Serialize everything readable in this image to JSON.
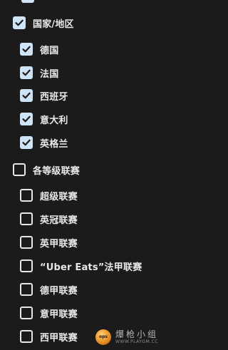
{
  "filters": {
    "country_group": {
      "label": "国家/地区",
      "checked": true,
      "items": [
        {
          "label": "德国",
          "checked": true
        },
        {
          "label": "法国",
          "checked": true
        },
        {
          "label": "西班牙",
          "checked": true
        },
        {
          "label": "意大利",
          "checked": true
        },
        {
          "label": "英格兰",
          "checked": true
        }
      ]
    },
    "league_group": {
      "label": "各等级联赛",
      "checked": false,
      "items": [
        {
          "label": "超级联赛",
          "checked": false
        },
        {
          "label": "英冠联赛",
          "checked": false
        },
        {
          "label": "英甲联赛",
          "checked": false
        },
        {
          "label": "“Uber Eats”法甲联赛",
          "checked": false
        },
        {
          "label": "德甲联赛",
          "checked": false
        },
        {
          "label": "意甲联赛",
          "checked": false
        },
        {
          "label": "西甲联赛",
          "checked": false
        }
      ]
    }
  },
  "watermark": {
    "logo_text": "ops",
    "text": "爆枪小组",
    "url": "WWW.PLAYGM.CC"
  },
  "colors": {
    "background": "#1b1b1b",
    "checkbox_checked": "#cfe3f6",
    "text": "#e9e9e9"
  }
}
